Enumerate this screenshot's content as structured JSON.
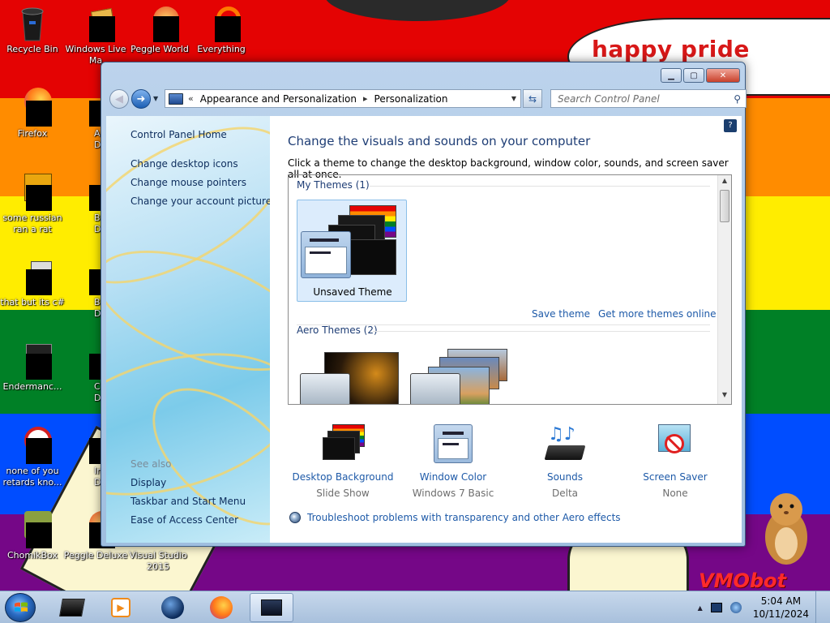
{
  "wallpaper": {
    "stripes": [
      "#e40303",
      "#ff8c00",
      "#ffed00",
      "#008026",
      "#004dff",
      "#750787"
    ],
    "speech_text": "happy pride month",
    "watermark": "VMObot"
  },
  "desktop_icons": [
    {
      "label": "Recycle Bin",
      "icon": "recycle-bin-icon"
    },
    {
      "label": "Windows Live Ma",
      "icon": "windows-live-icon"
    },
    {
      "label": "Peggle World",
      "icon": "peggle-icon"
    },
    {
      "label": "Everything",
      "icon": "everything-icon"
    },
    {
      "label": "Firefox",
      "icon": "firefox-icon"
    },
    {
      "label": "Astrol Delu",
      "icon": "game-icon"
    },
    {
      "label": "some russian ran a rat",
      "icon": "app-icon"
    },
    {
      "label": "Bejew Delu",
      "icon": "game-icon"
    },
    {
      "label": "that but its c#",
      "icon": "app-icon"
    },
    {
      "label": "Big Mo Delu",
      "icon": "game-icon"
    },
    {
      "label": "Endermanc...",
      "icon": "app-icon"
    },
    {
      "label": "Chuz Delu",
      "icon": "game-icon"
    },
    {
      "label": "none of you retards kno...",
      "icon": "app-icon"
    },
    {
      "label": "Insaniq Delu",
      "icon": "game-icon"
    },
    {
      "label": "ChomikBox",
      "icon": "chomikbox-icon"
    },
    {
      "label": "Peggle Deluxe",
      "icon": "peggle-icon"
    },
    {
      "label": "Visual Studio 2015",
      "icon": "visual-studio-icon"
    }
  ],
  "window": {
    "caption_buttons": {
      "minimize": "▁",
      "maximize": "▢",
      "close": "✕"
    },
    "address": {
      "overflow": "«",
      "crumbs": [
        "Appearance and Personalization",
        "Personalization"
      ],
      "separator": "▸"
    },
    "search": {
      "placeholder": "Search Control Panel"
    },
    "left_pane": {
      "home": "Control Panel Home",
      "links": [
        "Change desktop icons",
        "Change mouse pointers",
        "Change your account picture"
      ],
      "see_also_title": "See also",
      "see_also": [
        "Display",
        "Taskbar and Start Menu",
        "Ease of Access Center"
      ]
    },
    "content": {
      "title": "Change the visuals and sounds on your computer",
      "description": "Click a theme to change the desktop background, window color, sounds, and screen saver all at once.",
      "my_themes_header": "My Themes (1)",
      "my_theme_name": "Unsaved Theme",
      "save_theme": "Save theme",
      "get_more": "Get more themes online",
      "aero_header": "Aero Themes (2)",
      "bottom_items": [
        {
          "label": "Desktop Background",
          "sub": "Slide Show",
          "icon": "desktop-background-icon"
        },
        {
          "label": "Window Color",
          "sub": "Windows 7 Basic",
          "icon": "window-color-icon"
        },
        {
          "label": "Sounds",
          "sub": "Delta",
          "icon": "sounds-icon"
        },
        {
          "label": "Screen Saver",
          "sub": "None",
          "icon": "screen-saver-icon"
        }
      ],
      "troubleshoot": "Troubleshoot problems with transparency and other Aero effects"
    }
  },
  "taskbar": {
    "apps": [
      "media-player-icon",
      "media-center-icon",
      "firefox-icon",
      "control-panel-icon"
    ],
    "clock_time": "5:04 AM",
    "clock_date": "10/11/2024"
  }
}
